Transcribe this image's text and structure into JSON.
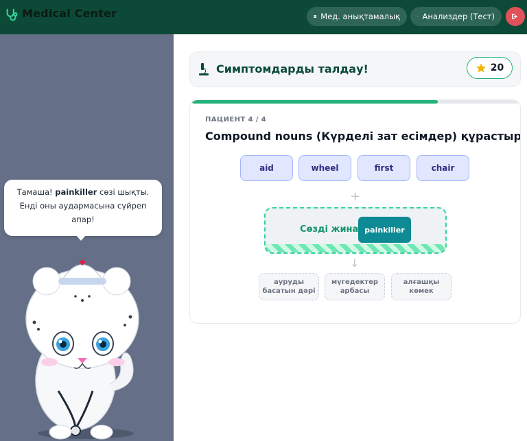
{
  "app": {
    "title": "Medical Center"
  },
  "header": {
    "med_reference_label": "Мед. анықтамалық",
    "tests_label": "Анализдер (Тест)"
  },
  "mascot": {
    "speech_prefix": "Тамаша! ",
    "speech_word": "painkiller",
    "speech_suffix": " сөзі шықты. Енді оны аудармасына сүйреп апар!"
  },
  "game": {
    "title": "Симптомдарды талдау!",
    "score": "20",
    "progress": 0.75,
    "patient_label": "ПАЦИЕНТ 4 / 4",
    "task": "Compound nouns (Күрделі зат есімдер) құрастыр.",
    "chips": [
      "aid",
      "wheel",
      "first",
      "chair"
    ],
    "plus_symbol": "+",
    "dropzone_label": "Сөзді жина",
    "built_word": "painkiller",
    "arrow_symbol": "↓",
    "targets": [
      "ауруды басатын дәрі",
      "мүгедектер арбасы",
      "алғашқы көмек"
    ]
  },
  "colors": {
    "header_bg": "#0c4a37",
    "accent_green": "#22b27a",
    "chip_bg": "#e0e7ff",
    "built_word_bg": "#0e8a94",
    "logout_bg": "#e0525a",
    "left_panel_bg": "#657088"
  },
  "icons": {
    "logo": "stethoscope-icon",
    "reference": "book-icon",
    "tests": "microscope-icon",
    "logout": "logout-icon",
    "title": "microscope-icon",
    "score": "star-icon"
  }
}
